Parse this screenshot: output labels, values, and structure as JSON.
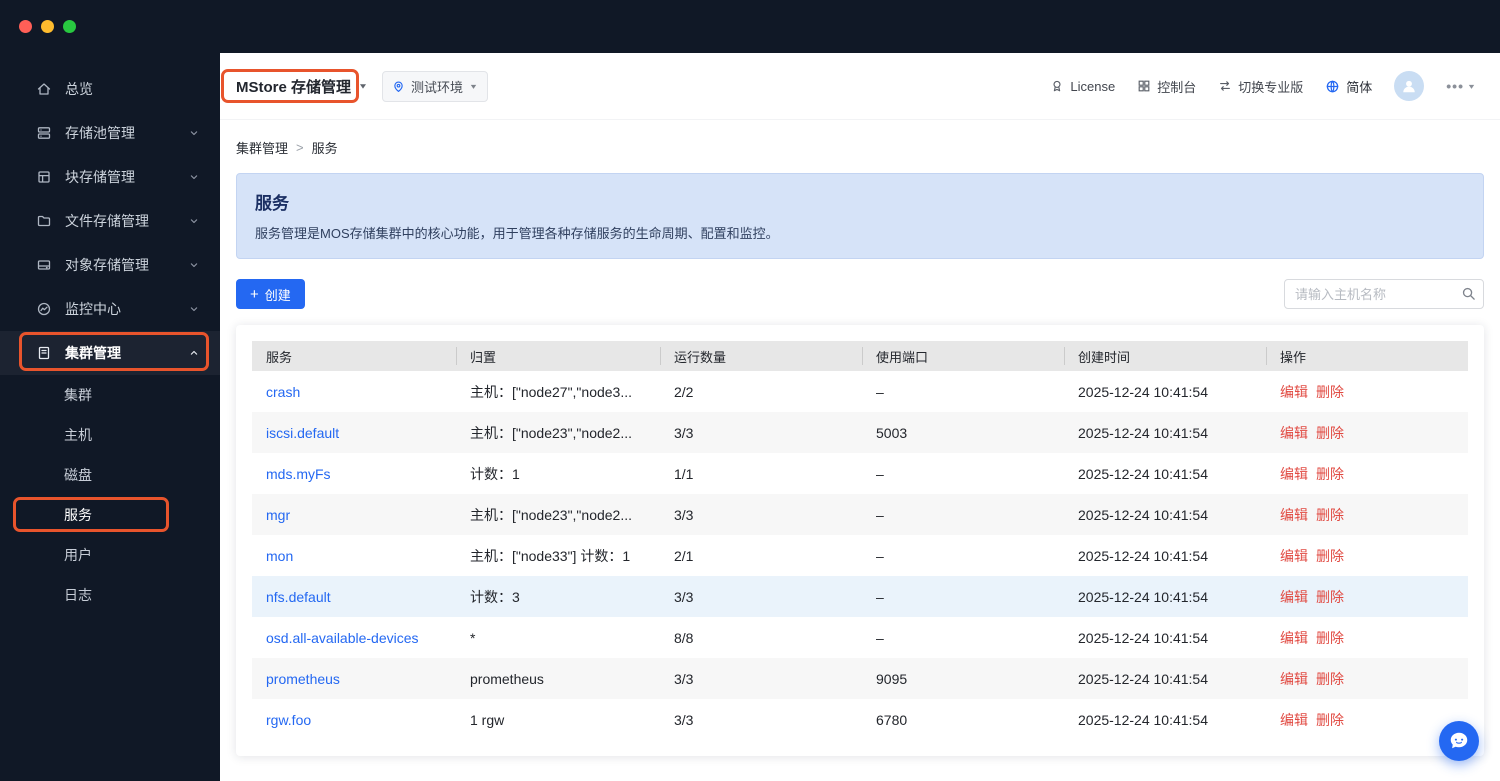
{
  "window": {
    "controls": [
      "close",
      "minimize",
      "zoom"
    ]
  },
  "sidebar": {
    "items": [
      {
        "label": "总览",
        "icon": "home-icon"
      },
      {
        "label": "存储池管理",
        "icon": "storage-pool-icon",
        "state": "collapsed"
      },
      {
        "label": "块存储管理",
        "icon": "block-storage-icon",
        "state": "collapsed"
      },
      {
        "label": "文件存储管理",
        "icon": "file-storage-icon",
        "state": "collapsed"
      },
      {
        "label": "对象存储管理",
        "icon": "object-storage-icon",
        "state": "collapsed"
      },
      {
        "label": "监控中心",
        "icon": "monitor-icon",
        "state": "collapsed"
      },
      {
        "label": "集群管理",
        "icon": "cluster-icon",
        "state": "expanded",
        "children": [
          {
            "label": "集群"
          },
          {
            "label": "主机"
          },
          {
            "label": "磁盘"
          },
          {
            "label": "服务",
            "active": true
          },
          {
            "label": "用户"
          },
          {
            "label": "日志"
          }
        ]
      }
    ]
  },
  "header": {
    "brand": "MStore 存储管理",
    "env_badge": "测试环境",
    "env_icon": "location-pin-icon",
    "actions": [
      {
        "label": "License",
        "icon": "license-icon"
      },
      {
        "label": "控制台",
        "icon": "console-icon"
      },
      {
        "label": "切换专业版",
        "icon": "switch-icon"
      },
      {
        "label": "简体",
        "icon": "globe-icon"
      }
    ]
  },
  "breadcrumb": {
    "items": [
      "集群管理",
      "服务"
    ],
    "separator": ">"
  },
  "banner": {
    "title": "服务",
    "description": "服务管理是MOS存储集群中的核心功能，用于管理各种存储服务的生命周期、配置和监控。"
  },
  "toolbar": {
    "create_label": "创建",
    "create_icon": "plus-icon",
    "search_placeholder": "请输入主机名称",
    "search_icon": "search-icon"
  },
  "table": {
    "columns": [
      "服务",
      "归置",
      "运行数量",
      "使用端口",
      "创建时间",
      "操作"
    ],
    "actions": {
      "edit": "编辑",
      "delete": "删除"
    },
    "rows": [
      {
        "service": "crash",
        "placement": "主机：[\"node27\",\"node3...",
        "running": "2/2",
        "port": "–",
        "created": "2025-12-24 10:41:54"
      },
      {
        "service": "iscsi.default",
        "placement": "主机：[\"node23\",\"node2...",
        "running": "3/3",
        "port": "5003",
        "created": "2025-12-24 10:41:54"
      },
      {
        "service": "mds.myFs",
        "placement": "计数：1",
        "running": "1/1",
        "port": "–",
        "created": "2025-12-24 10:41:54"
      },
      {
        "service": "mgr",
        "placement": "主机：[\"node23\",\"node2...",
        "running": "3/3",
        "port": "–",
        "created": "2025-12-24 10:41:54"
      },
      {
        "service": "mon",
        "placement": "主机：[\"node33\"] 计数：1",
        "running": "2/1",
        "port": "–",
        "created": "2025-12-24 10:41:54"
      },
      {
        "service": "nfs.default",
        "placement": "计数：3",
        "running": "3/3",
        "port": "–",
        "created": "2025-12-24 10:41:54",
        "highlighted": true
      },
      {
        "service": "osd.all-available-devices",
        "placement": "*",
        "running": "8/8",
        "port": "–",
        "created": "2025-12-24 10:41:54"
      },
      {
        "service": "prometheus",
        "placement": "prometheus",
        "running": "3/3",
        "port": "9095",
        "created": "2025-12-24 10:41:54"
      },
      {
        "service": "rgw.foo",
        "placement": "1 rgw",
        "running": "3/3",
        "port": "6780",
        "created": "2025-12-24 10:41:54"
      }
    ]
  },
  "fab": {
    "icon": "chat-icon"
  },
  "colors": {
    "accent": "#2468f2",
    "sidebar_bg": "#101826",
    "banner_bg": "#d6e3f8",
    "table_header_bg": "#e7e7e7",
    "zebra_row": "#f7f7f7",
    "highlight_row": "#eaf3fb",
    "action_red": "#e14a42",
    "annotation": "#e8542c"
  }
}
